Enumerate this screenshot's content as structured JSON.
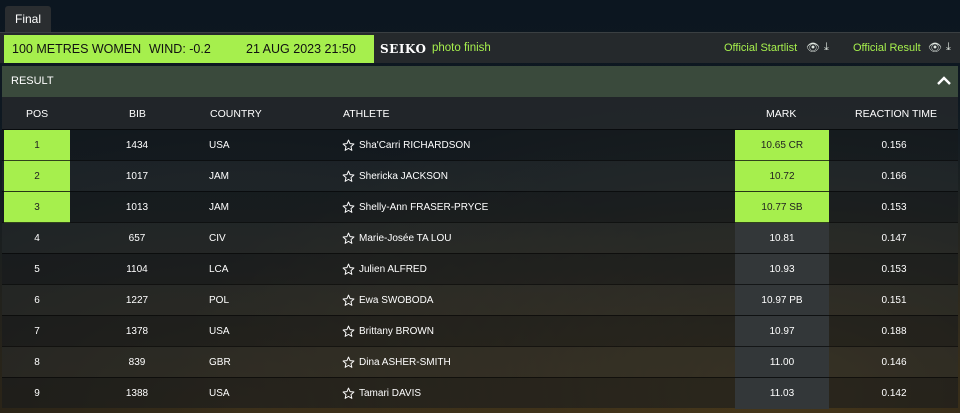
{
  "tab": {
    "label": "Final"
  },
  "info": {
    "event": "100 METRES WOMEN",
    "wind": "WIND: -0.2",
    "datetime": "21 AUG 2023 21:50",
    "sponsor": "SEIKO",
    "photo_finish": "photo finish",
    "startlist_label": "Official Startlist",
    "result_label": "Official Result"
  },
  "result": {
    "title": "RESULT"
  },
  "columns": {
    "pos": "POS",
    "bib": "BIB",
    "country": "COUNTRY",
    "athlete": "ATHLETE",
    "mark": "MARK",
    "reaction": "REACTION TIME"
  },
  "rows": [
    {
      "pos": "1",
      "bib": "1434",
      "country": "USA",
      "flag": "usa",
      "athlete": "Sha'Carri RICHARDSON",
      "mark": "10.65 CR",
      "reaction": "0.156",
      "medal": true
    },
    {
      "pos": "2",
      "bib": "1017",
      "country": "JAM",
      "flag": "jam",
      "athlete": "Shericka JACKSON",
      "mark": "10.72",
      "reaction": "0.166",
      "medal": true
    },
    {
      "pos": "3",
      "bib": "1013",
      "country": "JAM",
      "flag": "jam",
      "athlete": "Shelly-Ann FRASER-PRYCE",
      "mark": "10.77 SB",
      "reaction": "0.153",
      "medal": true
    },
    {
      "pos": "4",
      "bib": "657",
      "country": "CIV",
      "flag": "civ",
      "athlete": "Marie-Josée TA LOU",
      "mark": "10.81",
      "reaction": "0.147",
      "medal": false
    },
    {
      "pos": "5",
      "bib": "1104",
      "country": "LCA",
      "flag": "lca",
      "athlete": "Julien ALFRED",
      "mark": "10.93",
      "reaction": "0.153",
      "medal": false
    },
    {
      "pos": "6",
      "bib": "1227",
      "country": "POL",
      "flag": "pol",
      "athlete": "Ewa SWOBODA",
      "mark": "10.97 PB",
      "reaction": "0.151",
      "medal": false
    },
    {
      "pos": "7",
      "bib": "1378",
      "country": "USA",
      "flag": "usa",
      "athlete": "Brittany BROWN",
      "mark": "10.97",
      "reaction": "0.188",
      "medal": false
    },
    {
      "pos": "8",
      "bib": "839",
      "country": "GBR",
      "flag": "gbr",
      "athlete": "Dina ASHER-SMITH",
      "mark": "11.00",
      "reaction": "0.146",
      "medal": false
    },
    {
      "pos": "9",
      "bib": "1388",
      "country": "USA",
      "flag": "usa",
      "athlete": "Tamari DAVIS",
      "mark": "11.03",
      "reaction": "0.142",
      "medal": false
    }
  ],
  "colors": {
    "accent": "#a6ef4d",
    "panel": "#25292c",
    "result_header": "#3a4a3c"
  }
}
